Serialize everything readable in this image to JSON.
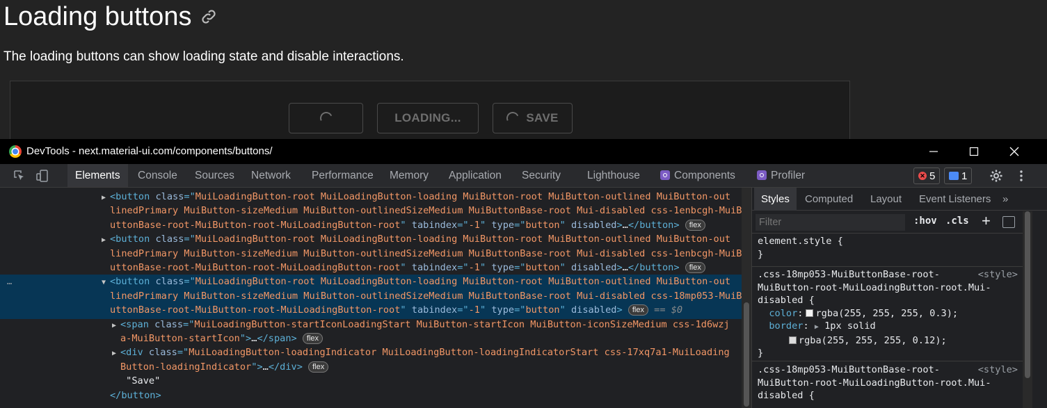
{
  "page": {
    "title": "Loading buttons",
    "description": "The loading buttons can show loading state and disable interactions.",
    "demo_buttons": [
      {
        "label": ""
      },
      {
        "label": "LOADING..."
      },
      {
        "label": "SAVE"
      }
    ]
  },
  "devtools": {
    "window_title": "DevTools - next.material-ui.com/components/buttons/",
    "tabs": [
      "Elements",
      "Console",
      "Sources",
      "Network",
      "Performance",
      "Memory",
      "Application",
      "Security",
      "Lighthouse",
      "Components",
      "Profiler"
    ],
    "active_tab": "Elements",
    "error_count": "5",
    "message_count": "1",
    "elements": {
      "rows": [
        {
          "indent": "    ",
          "tri": "▶",
          "parts": [
            [
              "tag",
              "<button "
            ],
            [
              "attr",
              "class"
            ],
            [
              "tag",
              "=\""
            ],
            [
              "aval",
              "MuiLoadingButton-root MuiLoadingButton-loading MuiButton-root MuiButton-outlined MuiButton-out"
            ]
          ]
        },
        {
          "indent": "    ",
          "tri": " ",
          "parts": [
            [
              "aval",
              "linedPrimary MuiButton-sizeMedium MuiButton-outlinedSizeMedium MuiButtonBase-root Mui-disabled css-1enbcgh-MuiB"
            ]
          ]
        },
        {
          "indent": "    ",
          "tri": " ",
          "parts": [
            [
              "aval",
              "uttonBase-root-MuiButton-root-MuiLoadingButton-root"
            ],
            [
              "tag",
              "\" "
            ],
            [
              "attr",
              "tabindex"
            ],
            [
              "tag",
              "=\""
            ],
            [
              "aval",
              "-1"
            ],
            [
              "tag",
              "\" "
            ],
            [
              "attr",
              "type"
            ],
            [
              "tag",
              "=\""
            ],
            [
              "aval",
              "button"
            ],
            [
              "tag",
              "\" "
            ],
            [
              "attr",
              "disabled"
            ],
            [
              "tag",
              ">"
            ],
            [
              "txt",
              "…"
            ],
            [
              "tag",
              "</button>"
            ]
          ],
          "flex": "flex"
        },
        {
          "indent": "    ",
          "tri": "▶",
          "parts": [
            [
              "tag",
              "<button "
            ],
            [
              "attr",
              "class"
            ],
            [
              "tag",
              "=\""
            ],
            [
              "aval",
              "MuiLoadingButton-root MuiLoadingButton-loading MuiButton-root MuiButton-outlined MuiButton-out"
            ]
          ]
        },
        {
          "indent": "    ",
          "tri": " ",
          "parts": [
            [
              "aval",
              "linedPrimary MuiButton-sizeMedium MuiButton-outlinedSizeMedium MuiButtonBase-root Mui-disabled css-1enbcgh-MuiB"
            ]
          ]
        },
        {
          "indent": "    ",
          "tri": " ",
          "parts": [
            [
              "aval",
              "uttonBase-root-MuiButton-root-MuiLoadingButton-root"
            ],
            [
              "tag",
              "\" "
            ],
            [
              "attr",
              "tabindex"
            ],
            [
              "tag",
              "=\""
            ],
            [
              "aval",
              "-1"
            ],
            [
              "tag",
              "\" "
            ],
            [
              "attr",
              "type"
            ],
            [
              "tag",
              "=\""
            ],
            [
              "aval",
              "button"
            ],
            [
              "tag",
              "\" "
            ],
            [
              "attr",
              "disabled"
            ],
            [
              "tag",
              ">"
            ],
            [
              "txt",
              "…"
            ],
            [
              "tag",
              "</button>"
            ]
          ],
          "flex": "flex"
        },
        {
          "indent": "    ",
          "tri": "▼",
          "sel": true,
          "parts": [
            [
              "tag",
              "<button "
            ],
            [
              "attr",
              "class"
            ],
            [
              "tag",
              "=\""
            ],
            [
              "aval",
              "MuiLoadingButton-root MuiLoadingButton-loading MuiButton-root MuiButton-outlined MuiButton-out"
            ]
          ]
        },
        {
          "indent": "    ",
          "tri": " ",
          "sel": true,
          "parts": [
            [
              "aval",
              "linedPrimary MuiButton-sizeMedium MuiButton-outlinedSizeMedium MuiButtonBase-root Mui-disabled css-18mp053-MuiB"
            ]
          ]
        },
        {
          "indent": "    ",
          "tri": " ",
          "sel": true,
          "parts": [
            [
              "aval",
              "uttonBase-root-MuiButton-root-MuiLoadingButton-root"
            ],
            [
              "tag",
              "\" "
            ],
            [
              "attr",
              "tabindex"
            ],
            [
              "tag",
              "=\""
            ],
            [
              "aval",
              "-1"
            ],
            [
              "tag",
              "\" "
            ],
            [
              "attr",
              "type"
            ],
            [
              "tag",
              "=\""
            ],
            [
              "aval",
              "button"
            ],
            [
              "tag",
              "\" "
            ],
            [
              "attr",
              "disabled"
            ],
            [
              "tag",
              ">"
            ]
          ],
          "flex": "flex",
          "eq": "== $0"
        },
        {
          "indent": "     ",
          "tri": "▶",
          "parts": [
            [
              "tag",
              "<span "
            ],
            [
              "attr",
              "class"
            ],
            [
              "tag",
              "=\""
            ],
            [
              "aval",
              "MuiLoadingButton-startIconLoadingStart MuiButton-startIcon MuiButton-iconSizeMedium css-1d6wzj"
            ]
          ]
        },
        {
          "indent": "     ",
          "tri": " ",
          "parts": [
            [
              "aval",
              "a-MuiButton-startIcon"
            ],
            [
              "tag",
              "\">"
            ],
            [
              "txt",
              "…"
            ],
            [
              "tag",
              "</span>"
            ]
          ],
          "flex": "flex"
        },
        {
          "indent": "     ",
          "tri": "▶",
          "parts": [
            [
              "tag",
              "<div "
            ],
            [
              "attr",
              "class"
            ],
            [
              "tag",
              "=\""
            ],
            [
              "aval",
              "MuiLoadingButton-loadingIndicator MuiLoadingButton-loadingIndicatorStart css-17xq7a1-MuiLoading"
            ]
          ]
        },
        {
          "indent": "     ",
          "tri": " ",
          "parts": [
            [
              "aval",
              "Button-loadingIndicator"
            ],
            [
              "tag",
              "\">"
            ],
            [
              "txt",
              "…"
            ],
            [
              "tag",
              "</div>"
            ]
          ],
          "flex": "flex"
        },
        {
          "indent": "     ",
          "tri": " ",
          "parts": [
            [
              "txt",
              " \"Save\""
            ]
          ]
        },
        {
          "indent": "    ",
          "tri": " ",
          "parts": [
            [
              "tag",
              "</button>"
            ]
          ]
        }
      ]
    },
    "styles": {
      "tabs": [
        "Styles",
        "Computed",
        "Layout",
        "Event Listeners"
      ],
      "more": "»",
      "filter_placeholder": "Filter",
      "hov": ":hov",
      "cls": ".cls",
      "plus": "+",
      "element_style_open": "element.style {",
      "close_brace": "}",
      "rule1_sel": [
        ".css-18mp053-MuiButtonBase-root-",
        "MuiButton-root-MuiLoadingButton-root.Mui-",
        "disabled {"
      ],
      "rule1_src": "<style>",
      "color_prop": "color",
      "color_val": "rgba(255, 255, 255, 0.3);",
      "border_prop": "border",
      "border_val": "1px solid",
      "border_color": "rgba(255, 255, 255, 0.12);",
      "rule2_sel": [
        ".css-18mp053-MuiButtonBase-root-",
        "MuiButton-root-MuiLoadingButton-root.Mui-",
        "disabled {"
      ],
      "rule2_src": "<style>"
    }
  }
}
